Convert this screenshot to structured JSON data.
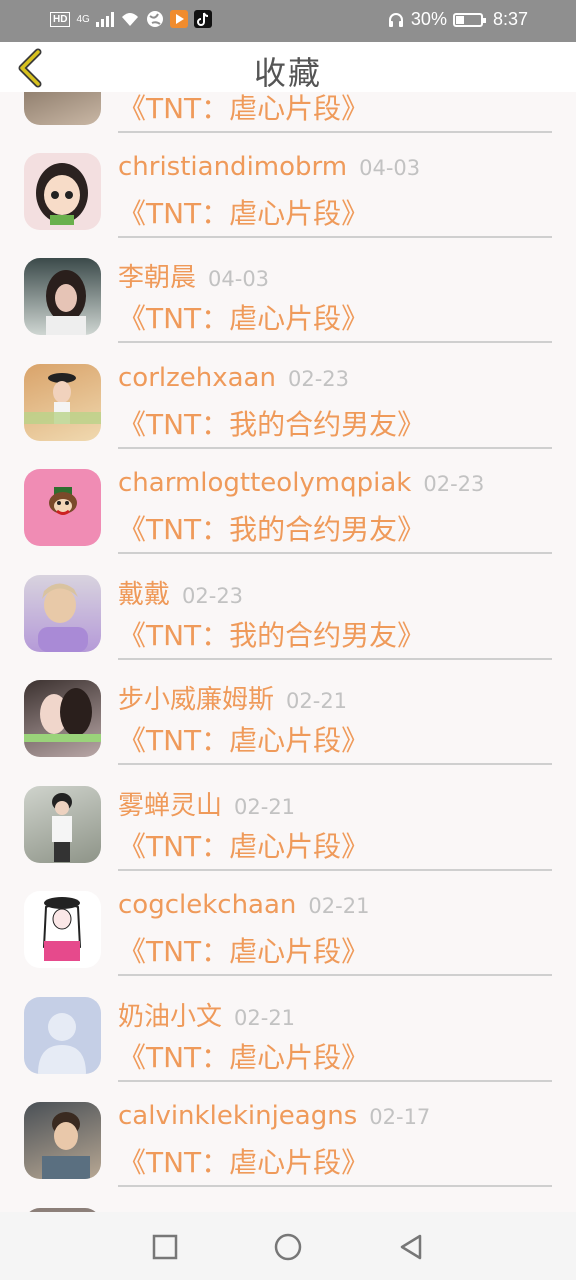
{
  "status_bar": {
    "network": "4G",
    "battery": "30%",
    "time": "8:37"
  },
  "header": {
    "title": "收藏",
    "back_icon": "chevron-left-icon"
  },
  "colors": {
    "accent": "#ef9a5a",
    "date": "#c2c2c2",
    "back_arrow": "#d8c21e"
  },
  "favorites": [
    {
      "name": "",
      "date": "",
      "work": "《TNT：虐心片段》"
    },
    {
      "name": "christiandimobrm",
      "date": "04-03",
      "work": "《TNT：虐心片段》"
    },
    {
      "name": "李朝晨",
      "date": "04-03",
      "work": "《TNT：虐心片段》"
    },
    {
      "name": "corlzehxaan",
      "date": "02-23",
      "work": "《TNT：我的合约男友》"
    },
    {
      "name": "charmlogtteolymqpiak",
      "date": "02-23",
      "work": "《TNT：我的合约男友》"
    },
    {
      "name": "戴戴",
      "date": "02-23",
      "work": "《TNT：我的合约男友》"
    },
    {
      "name": "步小威廉姆斯",
      "date": "02-21",
      "work": "《TNT：虐心片段》"
    },
    {
      "name": "雾蝉灵山",
      "date": "02-21",
      "work": "《TNT：虐心片段》"
    },
    {
      "name": "cogclekchaan",
      "date": "02-21",
      "work": "《TNT：虐心片段》"
    },
    {
      "name": "奶油小文",
      "date": "02-21",
      "work": "《TNT：虐心片段》"
    },
    {
      "name": "calvinklekinjeagns",
      "date": "02-17",
      "work": "《TNT：虐心片段》"
    }
  ],
  "nav_bar": {
    "recent_icon": "square-icon",
    "home_icon": "circle-icon",
    "back_icon": "triangle-back-icon"
  }
}
